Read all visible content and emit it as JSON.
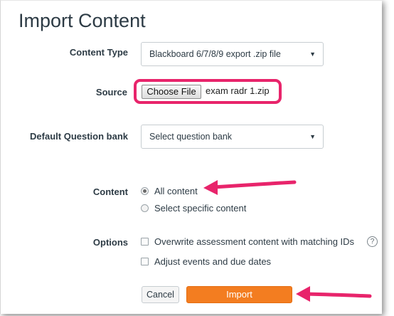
{
  "title": "Import Content",
  "content_type": {
    "label": "Content Type",
    "value": "Blackboard 6/7/8/9 export .zip file"
  },
  "source": {
    "label": "Source",
    "button": "Choose File",
    "file_name": "exam radr 1.zip"
  },
  "question_bank": {
    "label": "Default Question bank",
    "value": "Select question bank"
  },
  "content": {
    "label": "Content",
    "options": [
      {
        "label": "All content",
        "selected": true
      },
      {
        "label": "Select specific content",
        "selected": false
      }
    ]
  },
  "options": {
    "label": "Options",
    "items": [
      {
        "label": "Overwrite assessment content with matching IDs",
        "checked": false
      },
      {
        "label": "Adjust events and due dates",
        "checked": false
      }
    ],
    "help_glyph": "?"
  },
  "buttons": {
    "cancel": "Cancel",
    "import": "Import"
  },
  "colors": {
    "highlight": "#e8246b",
    "primary": "#f37d20"
  }
}
